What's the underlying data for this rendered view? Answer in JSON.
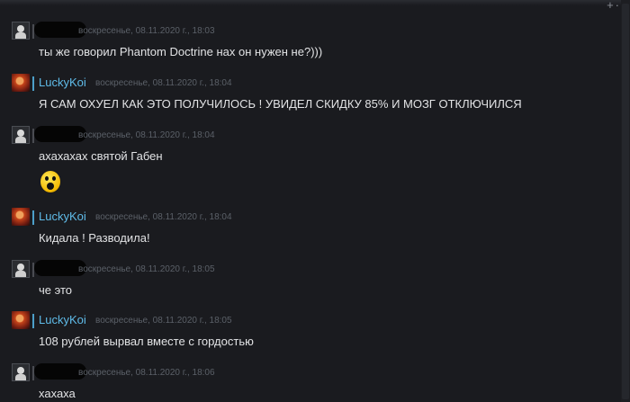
{
  "top_corner_icon": "expand-collapse-icon",
  "colors": {
    "background": "#1a1b1f",
    "username": "#5fbbe8",
    "timestamp": "#5b6068",
    "text": "#e2e3e5"
  },
  "messages": [
    {
      "author": "",
      "timestamp": "воскресенье, 08.11.2020 г., 18:03",
      "text": "ты же говорил Phantom Doctrine нах он нужен не?)))"
    },
    {
      "author": "LuckyKoi",
      "timestamp": "воскресенье, 08.11.2020 г., 18:04",
      "text": "Я САМ ОХУЕЛ КАК ЭТО ПОЛУЧИЛОСЬ ! УВИДЕЛ СКИДКУ 85% И МОЗГ ОТКЛЮЧИЛСЯ"
    },
    {
      "author": "",
      "timestamp": "воскресенье, 08.11.2020 г., 18:04",
      "text": "ахахахах святой Габен",
      "emoji": "shocked-face-emoji"
    },
    {
      "author": "LuckyKoi",
      "timestamp": "воскресенье, 08.11.2020 г., 18:04",
      "text": "Кидала ! Разводила!"
    },
    {
      "author": "",
      "timestamp": "воскресенье, 08.11.2020 г., 18:05",
      "text": "че это"
    },
    {
      "author": "LuckyKoi",
      "timestamp": "воскресенье, 08.11.2020 г., 18:05",
      "text": "108 рублей вырвал вместе с гордостью"
    },
    {
      "author": "",
      "timestamp": "воскресенье, 08.11.2020 г., 18:06",
      "text": "хахаха"
    }
  ]
}
